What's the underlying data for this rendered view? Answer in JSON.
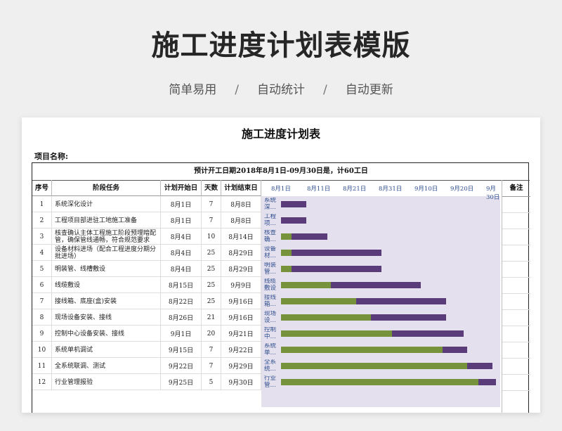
{
  "hero": {
    "title": "施工进度计划表模版",
    "subtitle": [
      "简单易用",
      "自动统计",
      "自动更新"
    ],
    "separator": "/"
  },
  "sheet": {
    "title": "施工进度计划表",
    "project_label": "项目名称:",
    "banner": "预计开工日期2018年8月1日-09月30日是，计60工日",
    "headers": [
      "序号",
      "阶段任务",
      "计划开始日",
      "天数",
      "计划结束日"
    ],
    "remark_header": "备注",
    "axis_labels": [
      "8月1日",
      "8月11日",
      "8月21日",
      "8月31日",
      "9月10日",
      "9月20日",
      "9月30日"
    ],
    "rows": [
      {
        "no": "1",
        "task": "系统深化设计",
        "start": "8月1日",
        "days": "7",
        "end": "8月8日",
        "glabel": "系统深…"
      },
      {
        "no": "2",
        "task": "工程项目部进驻工地施工准备",
        "start": "8月1日",
        "days": "7",
        "end": "8月8日",
        "glabel": "工程项…"
      },
      {
        "no": "3",
        "task": "核查确认主体工程施工阶段预埋暗配管，确保管线通畅，符合规范要求",
        "start": "8月4日",
        "days": "10",
        "end": "8月14日",
        "glabel": "核查确…"
      },
      {
        "no": "4",
        "task": "设备材料进场（配合工程进度分期分批进场）",
        "start": "8月4日",
        "days": "25",
        "end": "8月29日",
        "glabel": "设备材…"
      },
      {
        "no": "5",
        "task": "明装管、线槽敷设",
        "start": "8月4日",
        "days": "25",
        "end": "8月29日",
        "glabel": "明装管…"
      },
      {
        "no": "6",
        "task": "线缆敷设",
        "start": "8月15日",
        "days": "25",
        "end": "9月9日",
        "glabel": "线缆敷设"
      },
      {
        "no": "7",
        "task": "接线箱、底座(盒)安装",
        "start": "8月22日",
        "days": "25",
        "end": "9月16日",
        "glabel": "接线箱…"
      },
      {
        "no": "8",
        "task": "现场设备安装、接线",
        "start": "8月26日",
        "days": "21",
        "end": "9月16日",
        "glabel": "现场设…"
      },
      {
        "no": "9",
        "task": "控制中心设备安装、接线",
        "start": "9月1日",
        "days": "20",
        "end": "9月21日",
        "glabel": "控制中…"
      },
      {
        "no": "10",
        "task": "系统单机调试",
        "start": "9月15日",
        "days": "7",
        "end": "9月22日",
        "glabel": "系统单…"
      },
      {
        "no": "11",
        "task": "全系统联调、测试",
        "start": "9月22日",
        "days": "7",
        "end": "9月29日",
        "glabel": "全系统…"
      },
      {
        "no": "12",
        "task": "行业管理报验",
        "start": "9月25日",
        "days": "5",
        "end": "9月30日",
        "glabel": "行业管…"
      }
    ]
  },
  "chart_data": {
    "type": "bar",
    "orientation": "horizontal-stacked",
    "x_range_days": [
      0,
      60
    ],
    "x_tick_labels": [
      "8月1日",
      "8月11日",
      "8月21日",
      "8月31日",
      "9月10日",
      "9月20日",
      "9月30日"
    ],
    "categories": [
      "系统深化设计",
      "工程项目部进驻工地施工准备",
      "核查确认主体工程施工阶段预埋暗配管",
      "设备材料进场",
      "明装管、线槽敷设",
      "线缆敷设",
      "接线箱、底座(盒)安装",
      "现场设备安装、接线",
      "控制中心设备安装、接线",
      "系统单机调试",
      "全系统联调、测试",
      "行业管理报验"
    ],
    "series": [
      {
        "values": [
          0,
          0,
          3,
          3,
          3,
          14,
          21,
          25,
          31,
          45,
          52,
          55
        ],
        "color": "#76933c"
      },
      {
        "values": [
          7,
          7,
          10,
          25,
          25,
          25,
          25,
          21,
          20,
          7,
          7,
          5
        ],
        "color": "#5b3c7a"
      }
    ]
  },
  "colors": {
    "done": "#76933c",
    "todo": "#5b3c7a",
    "plot_bg": "#e4e0ee",
    "axis_text": "#2f4f8f"
  }
}
